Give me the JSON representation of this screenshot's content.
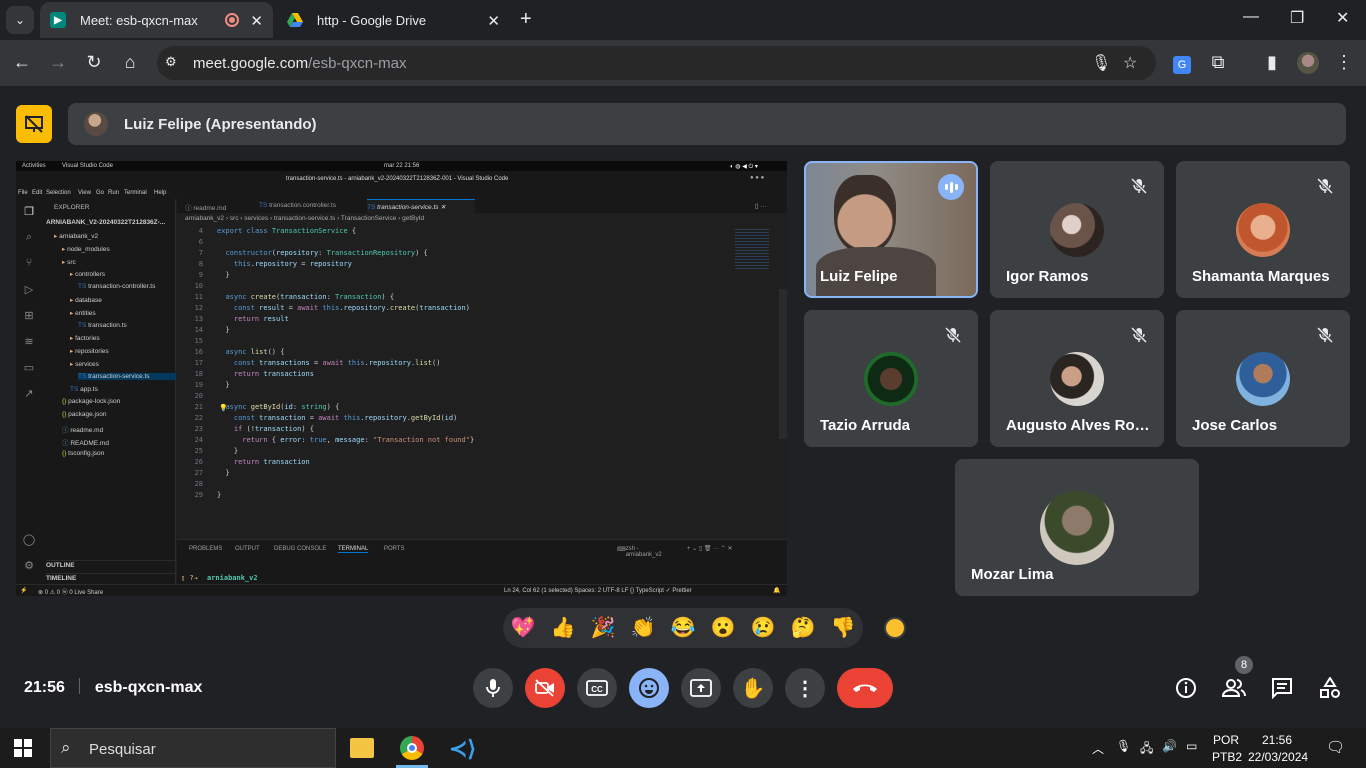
{
  "browser": {
    "tabs": [
      {
        "title": "Meet: esb-qxcn-max",
        "active": true,
        "recording": true
      },
      {
        "title": "http - Google Drive",
        "active": false
      }
    ],
    "url_host": "meet.google.com",
    "url_path": "/esb-qxcn-max"
  },
  "meet": {
    "presenter_label": "Luiz Felipe (Apresentando)",
    "meeting_time": "21:56",
    "meeting_code": "esb-qxcn-max",
    "participant_count": "8",
    "participants": [
      {
        "name": "Luiz Felipe",
        "speaking": true,
        "muted": false
      },
      {
        "name": "Igor Ramos",
        "muted": true
      },
      {
        "name": "Shamanta Marques",
        "muted": true
      },
      {
        "name": "Tazio Arruda",
        "muted": true
      },
      {
        "name": "Augusto Alves Rodr…",
        "muted": true
      },
      {
        "name": "Jose Carlos",
        "muted": true
      },
      {
        "name": "Mozar Lima",
        "muted": false
      }
    ],
    "reactions": [
      "💖",
      "👍",
      "🎉",
      "👏",
      "😂",
      "😮",
      "😢",
      "🤔",
      "👎"
    ]
  },
  "shared_screen": {
    "topbar": {
      "activities": "Activities",
      "app": "Visual Studio Code",
      "clock": "mar 22 21:56"
    },
    "window_title": "transaction-service.ts - arniabank_v2-20240322T212836Z-001 - Visual Studio Code",
    "menu": [
      "File",
      "Edit",
      "Selection",
      "View",
      "Go",
      "Run",
      "Terminal",
      "Help"
    ],
    "explorer_title": "EXPLORER",
    "workspace": "ARNIABANK_V2-20240322T212836Z-...",
    "tree": [
      {
        "label": "arniabank_v2",
        "depth": 1
      },
      {
        "label": "node_modules",
        "depth": 2
      },
      {
        "label": "src",
        "depth": 2
      },
      {
        "label": "controllers",
        "depth": 3
      },
      {
        "label": "transaction-controller.ts",
        "depth": 4
      },
      {
        "label": "database",
        "depth": 3
      },
      {
        "label": "entities",
        "depth": 3
      },
      {
        "label": "transaction.ts",
        "depth": 4
      },
      {
        "label": "factories",
        "depth": 3
      },
      {
        "label": "repositories",
        "depth": 3
      },
      {
        "label": "services",
        "depth": 3
      },
      {
        "label": "transaction-service.ts",
        "depth": 4,
        "selected": true
      },
      {
        "label": "app.ts",
        "depth": 3
      },
      {
        "label": "package-lock.json",
        "depth": 2
      },
      {
        "label": "package.json",
        "depth": 2
      },
      {
        "label": "readme.md",
        "depth": 2
      },
      {
        "label": "README.md",
        "depth": 2
      },
      {
        "label": "tsconfig.json",
        "depth": 2
      }
    ],
    "outline": "OUTLINE",
    "timeline": "TIMELINE",
    "editor_tabs": [
      "readme.md",
      "transaction.controller.ts",
      "transaction-service.ts"
    ],
    "breadcrumbs": "arniabank_v2 › src › services › transaction-service.ts › TransactionService › getById",
    "code": [
      {
        "n": "4",
        "html": "<span class='kw'>export</span> <span class='kw'>class</span> <span class='ty'>TransactionService</span> {"
      },
      {
        "n": "6",
        "html": ""
      },
      {
        "n": "7",
        "html": "  <span class='kw'>constructor</span>(<span class='vr'>repository</span>: <span class='ty'>TransactionRepository</span>) {"
      },
      {
        "n": "8",
        "html": "    <span class='kw'>this</span>.<span class='vr'>repository</span> = <span class='vr'>repository</span>"
      },
      {
        "n": "9",
        "html": "  }"
      },
      {
        "n": "10",
        "html": ""
      },
      {
        "n": "11",
        "html": "  <span class='kw'>async</span> <span class='fn'>create</span>(<span class='vr'>transaction</span>: <span class='ty'>Transaction</span>) {"
      },
      {
        "n": "12",
        "html": "    <span class='kw'>const</span> <span class='vr'>result</span> = <span class='ctl'>await</span> <span class='kw'>this</span>.<span class='vr'>repository</span>.<span class='fn'>create</span>(<span class='vr'>transaction</span>)"
      },
      {
        "n": "13",
        "html": "    <span class='ctl'>return</span> <span class='vr'>result</span>"
      },
      {
        "n": "14",
        "html": "  }"
      },
      {
        "n": "15",
        "html": ""
      },
      {
        "n": "16",
        "html": "  <span class='kw'>async</span> <span class='fn'>list</span>() {"
      },
      {
        "n": "17",
        "html": "    <span class='kw'>const</span> <span class='vr'>transactions</span> = <span class='ctl'>await</span> <span class='kw'>this</span>.<span class='vr'>repository</span>.<span class='fn'>list</span>()"
      },
      {
        "n": "18",
        "html": "    <span class='ctl'>return</span> <span class='vr'>transactions</span>"
      },
      {
        "n": "19",
        "html": "  }"
      },
      {
        "n": "20",
        "html": ""
      },
      {
        "n": "21",
        "html": "  <span class='kw'>async</span> <span class='fn'>getById</span>(<span class='vr'>id</span>: <span class='ty'>string</span>) {"
      },
      {
        "n": "22",
        "html": "    <span class='kw'>const</span> <span class='vr'>transaction</span> = <span class='ctl'>await</span> <span class='kw'>this</span>.<span class='vr'>repository</span>.<span class='fn'>getById</span>(<span class='vr'>id</span>)"
      },
      {
        "n": "23",
        "html": "    <span class='ctl'>if</span> (!<span class='vr'>transaction</span>) {"
      },
      {
        "n": "24",
        "html": "      <span class='ctl'>return</span> { <span class='vr'>error</span>: <span class='kw'>true</span>, <span class='vr'>message</span>: <span class='st'>\"Transaction not found\"</span>}"
      },
      {
        "n": "25",
        "html": "    }"
      },
      {
        "n": "26",
        "html": "    <span class='ctl'>return</span> <span class='vr'>transaction</span>"
      },
      {
        "n": "27",
        "html": "  }"
      },
      {
        "n": "28",
        "html": ""
      },
      {
        "n": "29",
        "html": "}"
      }
    ],
    "panel_tabs": [
      "PROBLEMS",
      "OUTPUT",
      "DEBUG CONSOLE",
      "TERMINAL",
      "PORTS"
    ],
    "terminal_tab": "zsh - arniabank_v2",
    "terminal_prompt": "arniabank_v2",
    "status_left": "⊗ 0 ⚠ 0   ⓦ 0   Live Share",
    "status_right": "Ln 24, Col 62 (1 selected)   Spaces: 2   UTF-8   LF   {} TypeScript   ✓ Prettier"
  },
  "taskbar": {
    "search_placeholder": "Pesquisar",
    "lang_top": "POR",
    "lang_bottom": "PTB2",
    "time": "21:56",
    "date": "22/03/2024"
  },
  "colors": {
    "meet_red": "#ea4335",
    "meet_blue": "#8ab4f8",
    "meet_yellow": "#fbbc04",
    "tile_bg": "#3c4043"
  }
}
